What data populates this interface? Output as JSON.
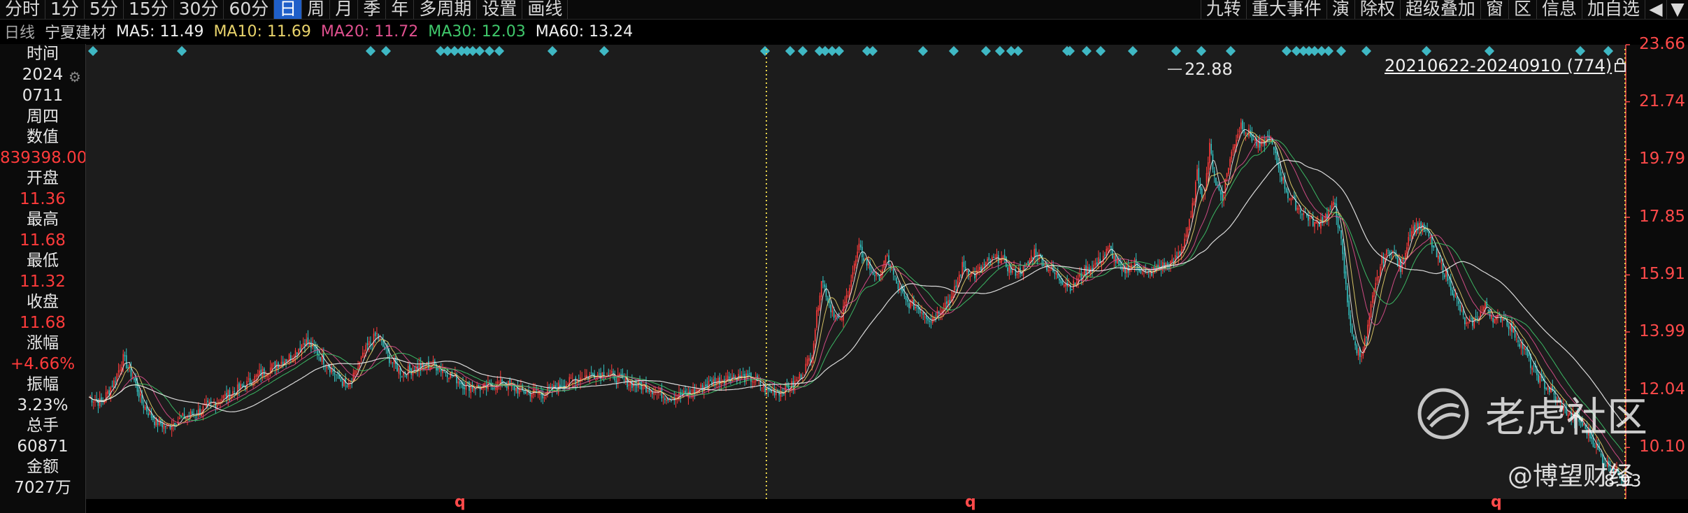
{
  "toolbar": {
    "periods": [
      {
        "label": "分时"
      },
      {
        "label": "1分"
      },
      {
        "label": "5分"
      },
      {
        "label": "15分"
      },
      {
        "label": "30分"
      },
      {
        "label": "60分"
      },
      {
        "label": "日",
        "active": true
      },
      {
        "label": "周"
      },
      {
        "label": "月"
      },
      {
        "label": "季"
      },
      {
        "label": "年"
      },
      {
        "label": "多周期"
      },
      {
        "label": "设置"
      },
      {
        "label": "画线"
      }
    ],
    "right": [
      "九转",
      "重大事件",
      "演",
      "除权",
      "超级叠加",
      "窗",
      "区",
      "信息",
      "加自选"
    ]
  },
  "legend": {
    "kind": "日线",
    "name": "宁夏建材",
    "ma": [
      {
        "label": "MA5: 11.49",
        "color": "#f0f0f0"
      },
      {
        "label": "MA10: 11.69",
        "color": "#e8d36b"
      },
      {
        "label": "MA20: 11.72",
        "color": "#e0508f"
      },
      {
        "label": "MA30: 12.03",
        "color": "#3fc86b"
      },
      {
        "label": "MA60: 13.24",
        "color": "#f0f0f0"
      }
    ]
  },
  "info": [
    {
      "k": "时间",
      "v": [
        "2024",
        "0711",
        "周四"
      ]
    },
    {
      "k": "数值",
      "v": [
        "839398.00"
      ],
      "red": true
    },
    {
      "k": "开盘",
      "v": [
        "11.36"
      ],
      "red": true
    },
    {
      "k": "最高",
      "v": [
        "11.68"
      ],
      "red": true
    },
    {
      "k": "最低",
      "v": [
        "11.32"
      ],
      "red": true
    },
    {
      "k": "收盘",
      "v": [
        "11.68"
      ],
      "red": true
    },
    {
      "k": "涨幅",
      "v": [
        "+4.66%"
      ],
      "red": true
    },
    {
      "k": "振幅",
      "v": [
        "3.23%"
      ]
    },
    {
      "k": "总手",
      "v": [
        "60871"
      ]
    },
    {
      "k": "金额",
      "v": [
        "7027万"
      ]
    }
  ],
  "range_label": "20210622-20240910 (774)",
  "watermark": {
    "text": "老虎社区",
    "sub": "@博望财经"
  },
  "colors": {
    "up": "#ff3b3b",
    "down": "#33c4c4",
    "signal": "#3fb8c4",
    "axis": "#ff4a4a",
    "bg": "#1c1c1c",
    "crosshair": "#e8d34a"
  },
  "chart_data": {
    "type": "candlestick",
    "ylim": [
      8.93,
      23.66
    ],
    "y_ticks": [
      23.66,
      21.74,
      19.79,
      17.85,
      15.91,
      13.99,
      12.04,
      10.1
    ],
    "x_range": [
      "20210622",
      "20240910"
    ],
    "count": 774,
    "highest": {
      "value": 22.88,
      "label": "22.88"
    },
    "lowest": {
      "value": 8.93,
      "label": "8.93"
    },
    "close_path": [
      [
        0,
        11.8
      ],
      [
        8,
        11.6
      ],
      [
        16,
        12.3
      ],
      [
        22,
        13.1
      ],
      [
        28,
        12.5
      ],
      [
        34,
        11.6
      ],
      [
        42,
        11.0
      ],
      [
        50,
        10.8
      ],
      [
        60,
        11.1
      ],
      [
        70,
        11.3
      ],
      [
        80,
        11.6
      ],
      [
        90,
        11.9
      ],
      [
        100,
        12.2
      ],
      [
        110,
        12.6
      ],
      [
        120,
        12.9
      ],
      [
        130,
        13.2
      ],
      [
        138,
        13.7
      ],
      [
        146,
        13.3
      ],
      [
        154,
        12.8
      ],
      [
        160,
        12.4
      ],
      [
        166,
        12.1
      ],
      [
        172,
        12.8
      ],
      [
        178,
        13.5
      ],
      [
        184,
        13.9
      ],
      [
        192,
        13.1
      ],
      [
        200,
        12.6
      ],
      [
        210,
        12.8
      ],
      [
        220,
        12.9
      ],
      [
        230,
        12.6
      ],
      [
        240,
        12.2
      ],
      [
        252,
        12.1
      ],
      [
        264,
        12.3
      ],
      [
        276,
        12.0
      ],
      [
        290,
        11.9
      ],
      [
        302,
        12.2
      ],
      [
        316,
        12.5
      ],
      [
        330,
        12.6
      ],
      [
        344,
        12.3
      ],
      [
        358,
        12.1
      ],
      [
        370,
        11.8
      ],
      [
        384,
        11.9
      ],
      [
        398,
        12.3
      ],
      [
        412,
        12.5
      ],
      [
        424,
        12.4
      ],
      [
        434,
        12.0
      ],
      [
        442,
        12.0
      ],
      [
        450,
        12.2
      ],
      [
        456,
        12.6
      ],
      [
        462,
        13.3
      ],
      [
        468,
        15.8
      ],
      [
        474,
        14.8
      ],
      [
        480,
        14.3
      ],
      [
        486,
        15.6
      ],
      [
        492,
        16.8
      ],
      [
        498,
        16.2
      ],
      [
        504,
        15.8
      ],
      [
        510,
        16.5
      ],
      [
        516,
        15.6
      ],
      [
        522,
        15.0
      ],
      [
        530,
        14.8
      ],
      [
        538,
        14.4
      ],
      [
        546,
        14.9
      ],
      [
        552,
        15.2
      ],
      [
        558,
        16.2
      ],
      [
        566,
        15.9
      ],
      [
        574,
        16.3
      ],
      [
        582,
        16.5
      ],
      [
        590,
        16.0
      ],
      [
        598,
        16.1
      ],
      [
        604,
        16.7
      ],
      [
        612,
        16.2
      ],
      [
        620,
        15.8
      ],
      [
        628,
        15.5
      ],
      [
        636,
        16.0
      ],
      [
        644,
        16.3
      ],
      [
        652,
        16.8
      ],
      [
        660,
        16.0
      ],
      [
        668,
        16.3
      ],
      [
        676,
        15.9
      ],
      [
        684,
        16.2
      ],
      [
        692,
        16.3
      ],
      [
        698,
        16.8
      ],
      [
        704,
        17.8
      ],
      [
        708,
        19.3
      ],
      [
        712,
        18.5
      ],
      [
        716,
        20.2
      ],
      [
        720,
        19.0
      ],
      [
        724,
        18.5
      ],
      [
        728,
        19.6
      ],
      [
        732,
        20.4
      ],
      [
        736,
        21.0
      ],
      [
        742,
        20.6
      ],
      [
        748,
        20.2
      ],
      [
        754,
        20.6
      ],
      [
        760,
        19.5
      ],
      [
        766,
        18.6
      ],
      [
        772,
        18.2
      ],
      [
        778,
        17.9
      ],
      [
        784,
        17.6
      ],
      [
        790,
        17.9
      ],
      [
        796,
        18.3
      ],
      [
        800,
        17.0
      ],
      [
        804,
        15.0
      ],
      [
        808,
        13.6
      ],
      [
        812,
        13.2
      ],
      [
        816,
        13.8
      ],
      [
        820,
        15.1
      ],
      [
        826,
        16.4
      ],
      [
        832,
        16.8
      ],
      [
        838,
        16.1
      ],
      [
        844,
        17.4
      ],
      [
        850,
        17.6
      ],
      [
        856,
        17.2
      ],
      [
        862,
        16.4
      ],
      [
        868,
        15.8
      ],
      [
        874,
        15.0
      ],
      [
        880,
        14.2
      ],
      [
        886,
        14.4
      ],
      [
        892,
        14.9
      ],
      [
        898,
        14.4
      ],
      [
        904,
        14.5
      ],
      [
        910,
        14.0
      ],
      [
        916,
        13.5
      ],
      [
        922,
        12.8
      ],
      [
        928,
        12.3
      ],
      [
        934,
        12.0
      ],
      [
        940,
        11.5
      ],
      [
        946,
        11.2
      ],
      [
        952,
        11.0
      ],
      [
        958,
        10.6
      ],
      [
        964,
        10.0
      ],
      [
        968,
        9.6
      ],
      [
        972,
        9.5
      ],
      [
        976,
        9.3
      ],
      [
        980,
        9.1
      ]
    ]
  }
}
